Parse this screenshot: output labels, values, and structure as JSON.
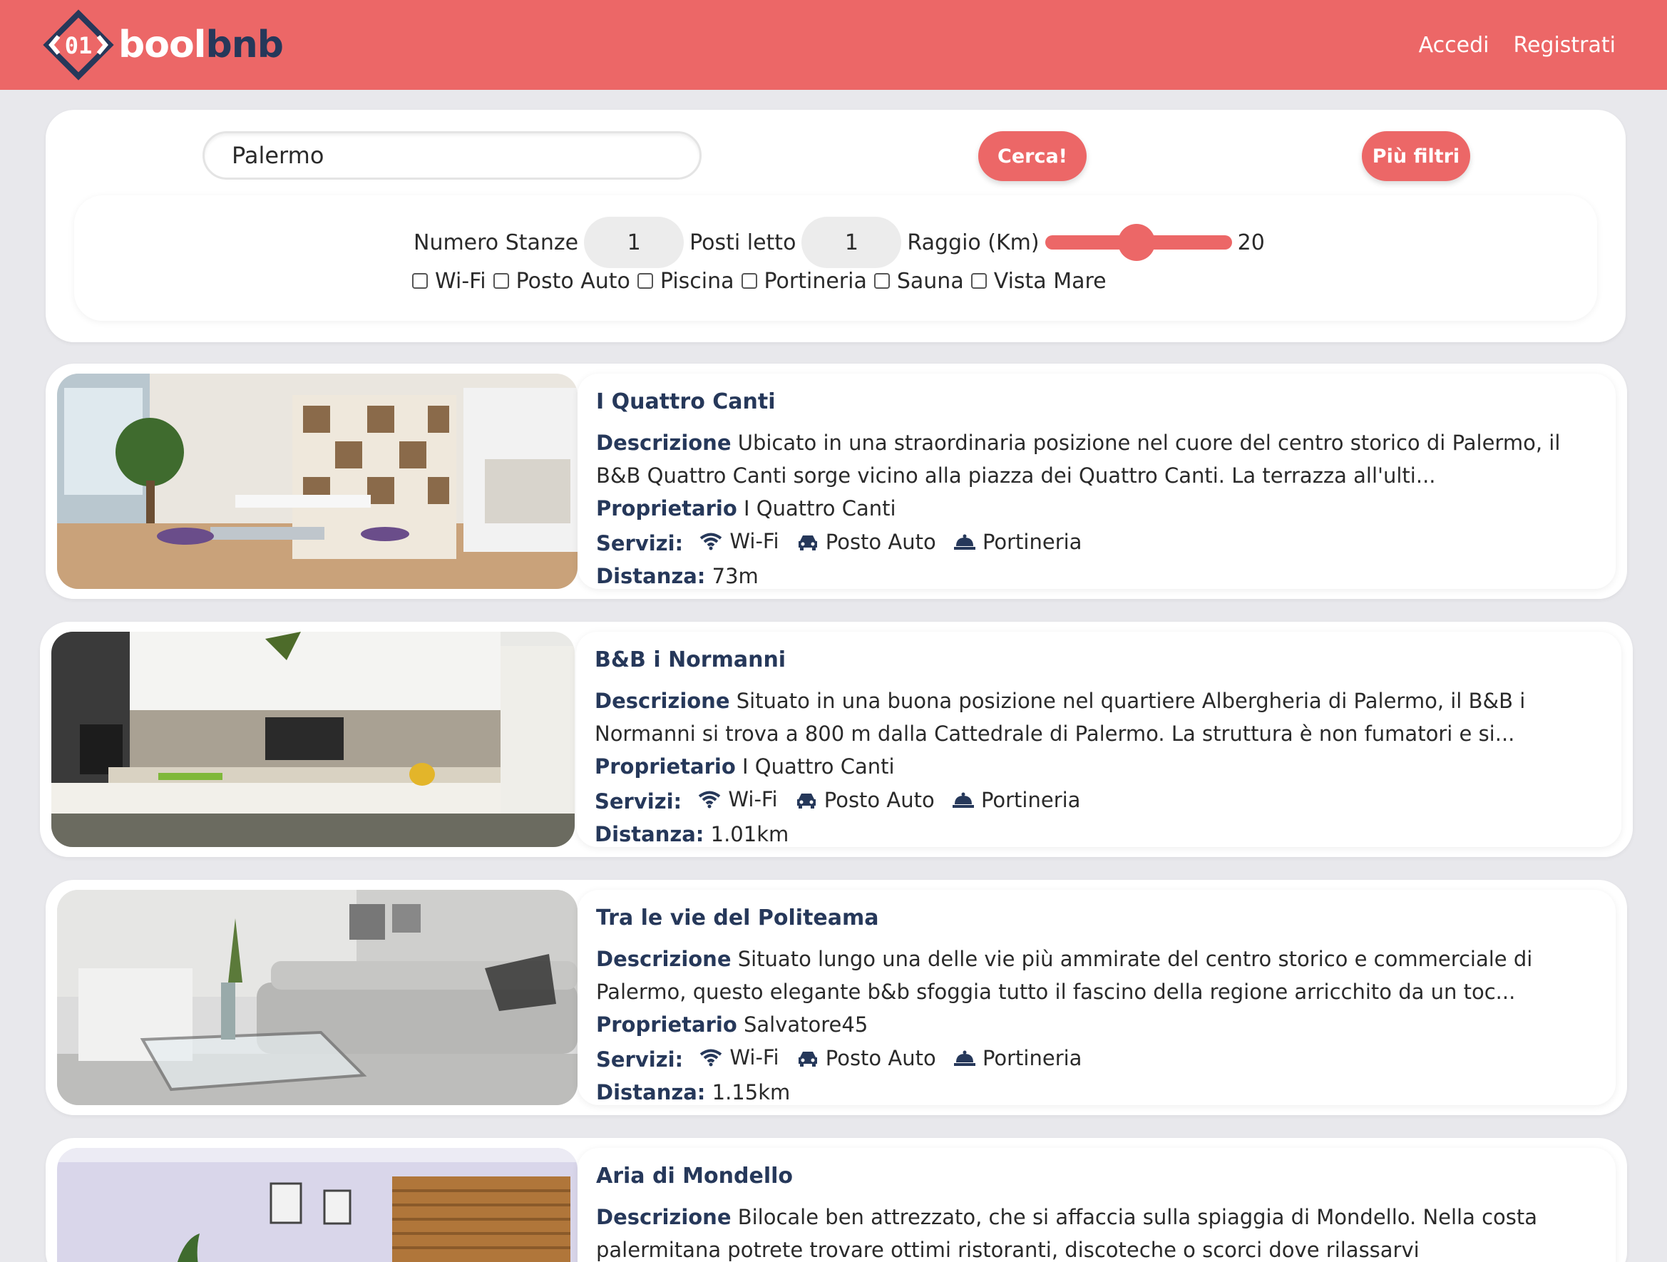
{
  "header": {
    "logo_text_1": "bool",
    "logo_text_2": "bnb",
    "nav": [
      {
        "label": "Accedi"
      },
      {
        "label": "Registrati"
      }
    ]
  },
  "search": {
    "value": "Palermo",
    "search_button": "Cerca!",
    "filters_button": "Più filtri"
  },
  "filters": {
    "rooms_label": "Numero Stanze",
    "rooms_value": "1",
    "beds_label": "Posti letto",
    "beds_value": "1",
    "radius_label": "Raggio (Km)",
    "radius_value": "20",
    "amenities": [
      "Wi-Fi",
      "Posto Auto",
      "Piscina",
      "Portineria",
      "Sauna",
      "Vista Mare"
    ]
  },
  "labels": {
    "description": "Descrizione",
    "owner": "Proprietario",
    "services": "Servizi:",
    "distance": "Distanza:"
  },
  "listings": [
    {
      "title": "I Quattro Canti",
      "description": "Ubicato in una straordinaria posizione nel cuore del centro storico di Palermo, il B&B Quattro Canti sorge vicino alla piazza dei Quattro Canti. La terrazza all'ulti...",
      "owner": "I Quattro Canti",
      "services": [
        "Wi-Fi",
        "Posto Auto",
        "Portineria"
      ],
      "distance": "73m"
    },
    {
      "title": "B&B i Normanni",
      "description": "Situato in una buona posizione nel quartiere Albergheria di Palermo, il B&B i Normanni si trova a 800 m dalla Cattedrale di Palermo. La struttura è non fumatori e si...",
      "owner": "I Quattro Canti",
      "services": [
        "Wi-Fi",
        "Posto Auto",
        "Portineria"
      ],
      "distance": "1.01km"
    },
    {
      "title": "Tra le vie del Politeama",
      "description": "Situato lungo una delle vie più ammirate del centro storico e commerciale di Palermo, questo elegante b&b sfoggia tutto il fascino della regione arricchito da un toc...",
      "owner": "Salvatore45",
      "services": [
        "Wi-Fi",
        "Posto Auto",
        "Portineria"
      ],
      "distance": "1.15km"
    },
    {
      "title": "Aria di Mondello",
      "description": "Bilocale ben attrezzato, che si affaccia sulla spiaggia di Mondello. Nella costa palermitana potrete trovare ottimi ristoranti, discoteche o scorci dove rilassarvi",
      "owner": "",
      "services": [],
      "distance": ""
    }
  ],
  "colors": {
    "accent": "#ec6767",
    "navy": "#26385a",
    "background": "#e8e8ec"
  }
}
